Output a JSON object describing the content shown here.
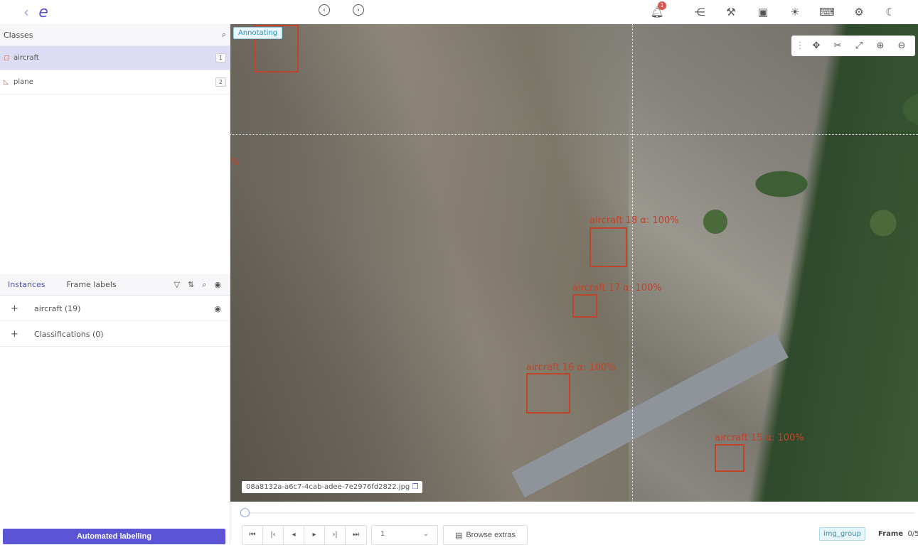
{
  "topbar": {
    "back_icon": "chevron-left-icon",
    "logo": "e",
    "prev_icon": "circle-arrow-left-icon",
    "next_icon": "circle-arrow-right-icon",
    "notification_count": "1",
    "icons": [
      "share-icon",
      "wrench-icon",
      "save-icon",
      "brightness-icon",
      "keyboard-icon",
      "gear-icon",
      "moon-icon"
    ]
  },
  "classes": {
    "title": "Classes",
    "items": [
      {
        "label": "aircraft",
        "count": "1",
        "icon": "bbox-icon"
      },
      {
        "label": "plane",
        "count": "2",
        "icon": "polygon-icon"
      }
    ]
  },
  "instances": {
    "tabs": [
      "Instances",
      "Frame labels"
    ],
    "groups": [
      {
        "label": "aircraft (19)"
      },
      {
        "label": "Classifications (0)"
      }
    ]
  },
  "automated_label": "Automated labelling",
  "canvas": {
    "status": "Annotating",
    "filename": "08a8132a-a6c7-4cab-adee-7e2976fd2822.jpg",
    "annotations": [
      {
        "label": "aircraft 18 α: 100%"
      },
      {
        "label": "aircraft 17 α: 100%"
      },
      {
        "label": "aircraft 16 α: 100%"
      },
      {
        "label": "aircraft 15 α: 100%"
      }
    ],
    "partial_label": "%",
    "accent": "#c0442a"
  },
  "player": {
    "frame_select": "1",
    "browse": "Browse extras",
    "group": "img_group",
    "frame_label": "Frame",
    "frame_value": "0/5"
  }
}
